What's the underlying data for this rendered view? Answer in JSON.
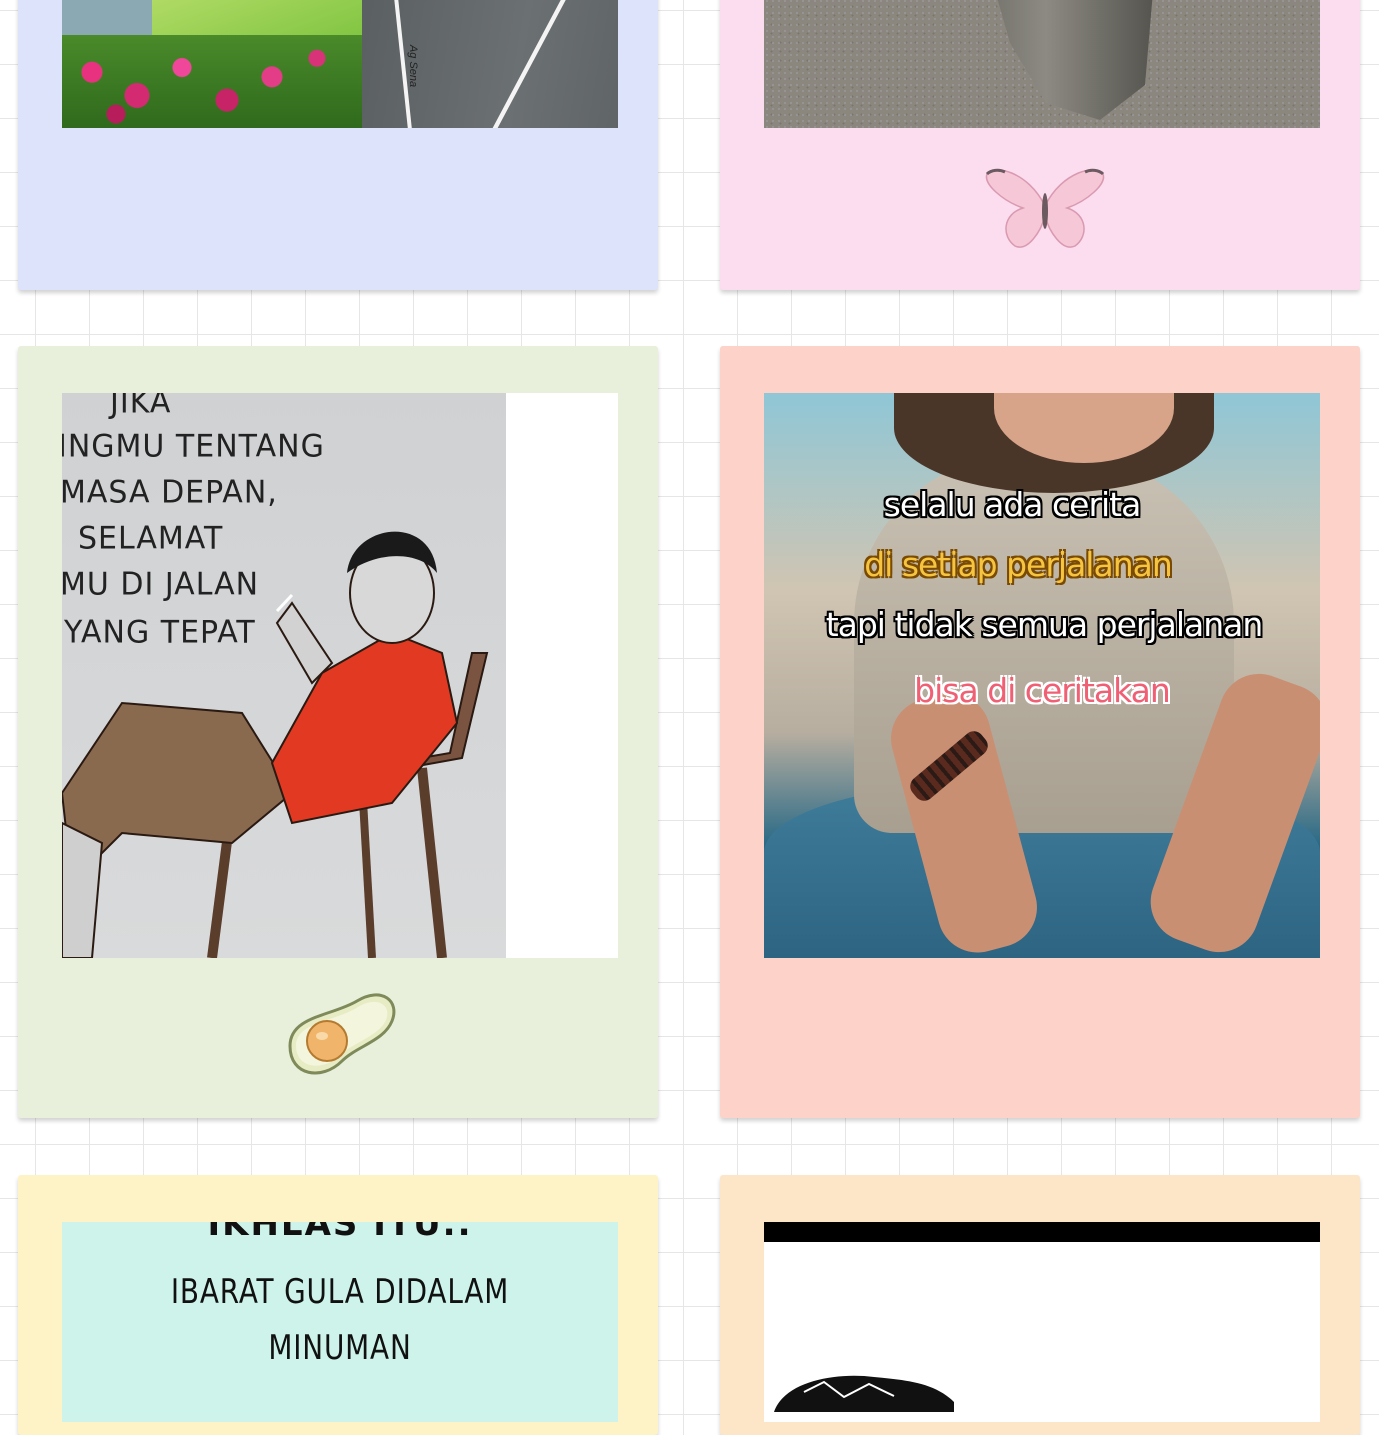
{
  "cards": {
    "road": {
      "watermark": "Ag Sena"
    },
    "illustration": {
      "lines": [
        "JIKA",
        "INGMU TENTANG",
        "MASA DEPAN,",
        "SELAMAT",
        "MU DI JALAN",
        "YANG TEPAT"
      ]
    },
    "traveler": {
      "captions": [
        "selalu ada cerita",
        "di setiap perjalanan",
        "tapi tidak semua perjalanan",
        "bisa di ceritakan"
      ]
    },
    "sugar": {
      "heading": "IKHLAS ITU..",
      "lines": [
        "IBARAT GULA DIDALAM",
        "MINUMAN"
      ]
    }
  },
  "colors": {
    "card_blue": "#dde3fb",
    "card_pink": "#fcdcef",
    "card_green": "#e8f0dc",
    "card_salmon": "#fcd2c9",
    "card_yellow": "#fdf3c7",
    "card_peach": "#fde5c8"
  },
  "icons": [
    "butterfly-icon",
    "avocado-icon"
  ]
}
